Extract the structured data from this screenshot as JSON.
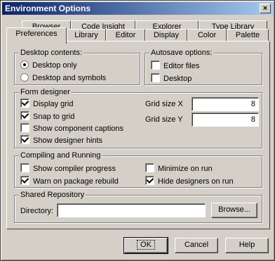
{
  "window": {
    "title": "Environment Options",
    "close_glyph": "×"
  },
  "tabs_back": [
    "Browser",
    "Code Insight",
    "Explorer",
    "Type Library"
  ],
  "tabs_front": [
    "Preferences",
    "Library",
    "Editor",
    "Display",
    "Color",
    "Palette"
  ],
  "active_tab": "Preferences",
  "desktop_contents": {
    "label": "Desktop contents:",
    "options": [
      "Desktop only",
      "Desktop and symbols"
    ],
    "selected": "Desktop only"
  },
  "autosave": {
    "label": "Autosave options:",
    "items": [
      {
        "label": "Editor files",
        "checked": false
      },
      {
        "label": "Desktop",
        "checked": false
      }
    ]
  },
  "form_designer": {
    "label": "Form designer",
    "items": [
      {
        "label": "Display grid",
        "checked": true
      },
      {
        "label": "Snap to grid",
        "checked": true
      },
      {
        "label": "Show component captions",
        "checked": false
      },
      {
        "label": "Show designer hints",
        "checked": true
      }
    ],
    "grid_x_label": "Grid size X",
    "grid_x_value": "8",
    "grid_y_label": "Grid size Y",
    "grid_y_value": "8"
  },
  "compiling": {
    "label": "Compiling and Running",
    "left": [
      {
        "label": "Show compiler progress",
        "checked": false
      },
      {
        "label": "Warn on package rebuild",
        "checked": true
      }
    ],
    "right": [
      {
        "label": "Minimize on run",
        "checked": false
      },
      {
        "label": "Hide designers on run",
        "checked": true
      }
    ]
  },
  "shared_repo": {
    "label": "Shared Repository",
    "directory_label": "Directory:",
    "directory_value": "",
    "browse_label": "Browse..."
  },
  "buttons": {
    "ok": "OK",
    "cancel": "Cancel",
    "help": "Help"
  }
}
